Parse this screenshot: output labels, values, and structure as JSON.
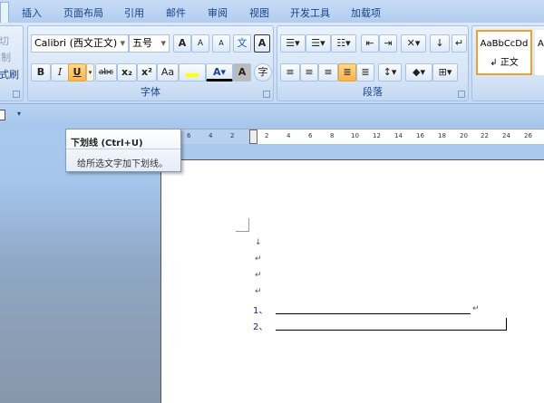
{
  "tabs": [
    "插入",
    "页面布局",
    "引用",
    "邮件",
    "审阅",
    "视图",
    "开发工具",
    "加载项"
  ],
  "clipboard": {
    "cut": "切",
    "copy": "制",
    "format_painter": "式刷"
  },
  "font": {
    "name": "Calibri (西文正文)",
    "size": "五号",
    "group_label": "字体",
    "bold": "B",
    "italic": "I",
    "underline": "U",
    "strike": "abc",
    "subscript": "x₂",
    "superscript": "x²",
    "change_case": "Aa",
    "grow": "A",
    "shrink": "A",
    "char_border": "A",
    "char_shading": "A",
    "enclose": "字",
    "phonetic": "文",
    "clear": "A"
  },
  "paragraph": {
    "group_label": "段落"
  },
  "styles": {
    "normal_preview": "AaBbCcDd",
    "normal_label": "正文",
    "next_preview": "A"
  },
  "ruler": {
    "numbers": [
      "6",
      "4",
      "2",
      "2",
      "4",
      "6",
      "8",
      "10",
      "12",
      "14",
      "16",
      "18",
      "20",
      "22",
      "24",
      "26"
    ]
  },
  "tooltip": {
    "title": "下划线 (Ctrl+U)",
    "desc": "给所选文字加下划线。"
  },
  "document": {
    "item1": "1、",
    "item2": "2、",
    "para_mark": "↵",
    "line_mark": "↓"
  }
}
